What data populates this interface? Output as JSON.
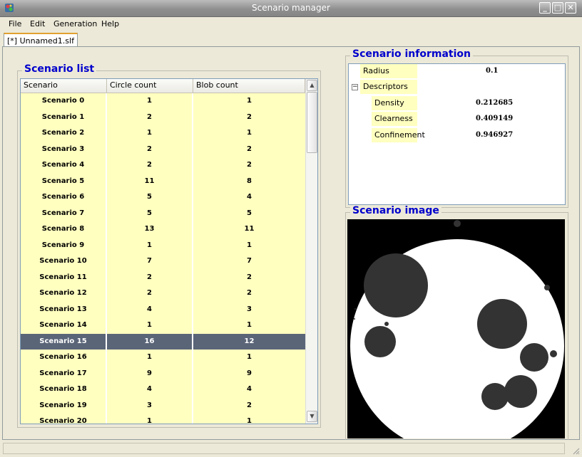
{
  "window": {
    "title": "Scenario manager",
    "buttons": [
      "_",
      "□",
      "✕"
    ]
  },
  "menu": [
    "File",
    "Edit",
    "Generation",
    "Help"
  ],
  "document_tab": "[*] Unnamed1.slf",
  "scenario_list": {
    "title": "Scenario list",
    "columns": [
      "Scenario",
      "Circle count",
      "Blob count"
    ],
    "selected_index": 15,
    "rows": [
      [
        "Scenario 0",
        "1",
        "1"
      ],
      [
        "Scenario 1",
        "2",
        "2"
      ],
      [
        "Scenario 2",
        "1",
        "1"
      ],
      [
        "Scenario 3",
        "2",
        "2"
      ],
      [
        "Scenario 4",
        "2",
        "2"
      ],
      [
        "Scenario 5",
        "11",
        "8"
      ],
      [
        "Scenario 6",
        "5",
        "4"
      ],
      [
        "Scenario 7",
        "5",
        "5"
      ],
      [
        "Scenario 8",
        "13",
        "11"
      ],
      [
        "Scenario 9",
        "1",
        "1"
      ],
      [
        "Scenario 10",
        "7",
        "7"
      ],
      [
        "Scenario 11",
        "2",
        "2"
      ],
      [
        "Scenario 12",
        "2",
        "2"
      ],
      [
        "Scenario 13",
        "4",
        "3"
      ],
      [
        "Scenario 14",
        "1",
        "1"
      ],
      [
        "Scenario 15",
        "16",
        "12"
      ],
      [
        "Scenario 16",
        "1",
        "1"
      ],
      [
        "Scenario 17",
        "9",
        "9"
      ],
      [
        "Scenario 18",
        "4",
        "4"
      ],
      [
        "Scenario 19",
        "3",
        "2"
      ],
      [
        "Scenario 20",
        "1",
        "1"
      ]
    ]
  },
  "scenario_info": {
    "title": "Scenario information",
    "radius_label": "Radius",
    "radius_value": "0.1",
    "descriptors_label": "Descriptors",
    "expander": "−",
    "descriptors": [
      {
        "label": "Density",
        "value": "0.212685"
      },
      {
        "label": "Clearness",
        "value": "0.409149"
      },
      {
        "label": "Confinement",
        "value": "0.946927"
      }
    ]
  },
  "scenario_image": {
    "title": "Scenario image",
    "background": "#000000",
    "disc_color": "#ffffff",
    "blob_color": "#333333"
  },
  "colors": {
    "row_highlight": "#ffffc0",
    "selected_row": "#5a6578",
    "group_title": "#0000cc"
  }
}
